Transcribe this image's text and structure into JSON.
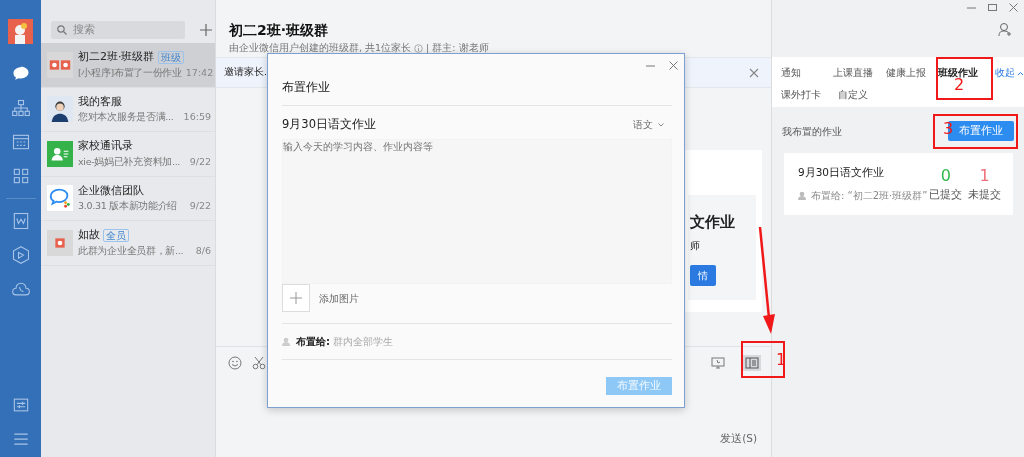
{
  "nav": {
    "items": [
      {
        "kind": "chat",
        "selected": true
      },
      {
        "kind": "org",
        "selected": false
      },
      {
        "kind": "calendar",
        "selected": false
      },
      {
        "kind": "apps",
        "selected": false
      },
      {
        "kind": "doc",
        "selected": false
      },
      {
        "kind": "cube",
        "selected": false
      },
      {
        "kind": "cloud",
        "selected": false
      },
      {
        "kind": "notes",
        "selected": false
      },
      {
        "kind": "menu",
        "selected": false
      }
    ]
  },
  "search": {
    "placeholder": "搜索"
  },
  "chats": [
    {
      "kind": "group",
      "name": "初二2班·班级群",
      "badge": "班级",
      "preview": "[小程序]布置了一份作业",
      "time": "17:42",
      "selected": true
    },
    {
      "kind": "photo",
      "name": "我的客服",
      "preview": "您对本次服务是否满...",
      "time": "16:59",
      "selected": false
    },
    {
      "kind": "contacts",
      "name": "家校通讯录",
      "preview": "xie-妈妈已补充资料加...",
      "time": "9/22",
      "selected": false
    },
    {
      "kind": "logo",
      "name": "企业微信团队",
      "preview": "3.0.31 版本新功能介绍",
      "time": "9/22",
      "selected": false
    },
    {
      "kind": "single",
      "name": "如故",
      "badge": "全员",
      "preview": "此群为企业全员群，新...",
      "time": "8/6",
      "selected": false
    }
  ],
  "header": {
    "title": "初二2班·班级群",
    "subtitle": "由企业微信用户创建的班级群, 共1位家长",
    "owner": "| 群主: 谢老师"
  },
  "invite_bar": {
    "text": "邀请家长."
  },
  "message_card": {
    "title": "文作业",
    "subtitle": "师",
    "button": "情"
  },
  "composer": {
    "send": "发送(S)"
  },
  "right_panel": {
    "tabs": [
      {
        "label": "通知",
        "selected": false
      },
      {
        "label": "上课直播",
        "selected": false
      },
      {
        "label": "健康上报",
        "selected": false
      },
      {
        "label": "班级作业",
        "selected": true
      },
      {
        "label": "课外打卡",
        "selected": false
      },
      {
        "label": "自定义",
        "selected": false
      }
    ],
    "collapse": "收起",
    "section_title": "我布置的作业",
    "assign_button": "布置作业",
    "assignments": [
      {
        "title": "9月30日语文作业",
        "assigned_label": "布置给:",
        "assigned_to": "“初二2班·班级群”",
        "submitted": "0",
        "submitted_label": "已提交",
        "pending": "1",
        "pending_label": "未提交"
      }
    ]
  },
  "dialog": {
    "title": "布置作业",
    "task_title": "9月30日语文作业",
    "subject": "语文",
    "placeholder": "输入今天的学习内容、作业内容等",
    "add_image": "添加图片",
    "assign_label": "布置给:",
    "assign_target": "群内全部学生",
    "submit": "布置作业",
    "submit_disabled": true
  },
  "annotations": [
    {
      "number": "1"
    },
    {
      "number": "2"
    },
    {
      "number": "3"
    }
  ]
}
